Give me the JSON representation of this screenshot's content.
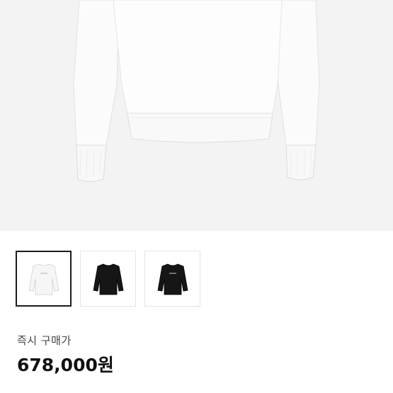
{
  "product": {
    "main_image_icon": "white-sweatshirt-image",
    "thumbnails": [
      {
        "name": "thumbnail-white-sweatshirt",
        "color": "#f7f7f7",
        "selected": true
      },
      {
        "name": "thumbnail-black-sweatshirt",
        "color": "#161616",
        "selected": false
      },
      {
        "name": "thumbnail-black-sweatshirt-logo",
        "color": "#161616",
        "selected": false
      }
    ],
    "price_label": "즉시 구매가",
    "price": "678,000원"
  }
}
